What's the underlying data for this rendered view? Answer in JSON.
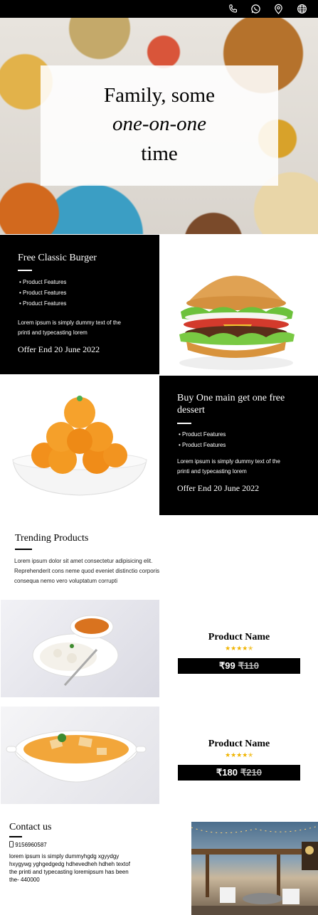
{
  "topbar": {
    "icons": [
      "phone-icon",
      "whatsapp-icon",
      "location-pin-icon",
      "globe-icon"
    ]
  },
  "hero": {
    "line1": "Family, some",
    "line2": "one-on-one",
    "line3": "time"
  },
  "offers": [
    {
      "title": "Free Classic Burger",
      "features": [
        "Product Features",
        "Product Features",
        "Product Features"
      ],
      "description_line1": "Lorem ipsum is simply dummy text of the",
      "description_line2": "printi and typecasting lorem",
      "offer_end": "Offer End 20 June 2022"
    },
    {
      "title_line1": "Buy One main get one free",
      "title_line2": "dessert",
      "features": [
        "Product Features",
        "Product Features"
      ],
      "description_line1": "Lorem ipsum is simply dummy text of the",
      "description_line2": "printi and typecasting lorem",
      "offer_end": "Offer End 20 June 2022"
    }
  ],
  "trending": {
    "title": "Trending Products",
    "description_line1": "Lorem ipsum dolor sit amet consectetur adipisicing elit.",
    "description_line2": "Reprehenderit cons neme quod eveniet distinctio corporis",
    "description_line3": "consequa nemo vero voluptatum corrupti"
  },
  "products": [
    {
      "name": "Product Name",
      "stars": "★★★★✭",
      "price": "₹99",
      "old_price": "₹110"
    },
    {
      "name": "Product Name",
      "stars": "★★★★✭",
      "price": "₹180",
      "old_price": "₹210"
    }
  ],
  "contact": {
    "title": "Contact us",
    "phone": "9156960587",
    "description_line1": "lorem ipsum is simply dummyhgdg xgyydgy",
    "description_line2": "hxygywg yghgedgedg hdhevedheh hdheh textof",
    "description_line3": "the printi and typecasting loremipsum has been",
    "description_line4": "the- 440000"
  },
  "colors": {
    "black": "#000000",
    "star": "#f0b400"
  }
}
